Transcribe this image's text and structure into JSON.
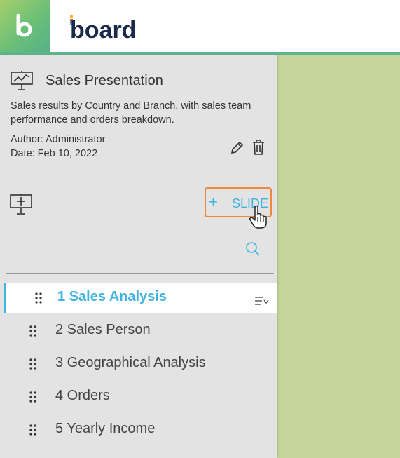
{
  "header": {
    "logo_text": "board"
  },
  "presentation": {
    "title": "Sales Presentation",
    "description": "Sales results by Country and Branch, with sales team performance and orders breakdown.",
    "author": "Author: Administrator",
    "date": "Date: Feb 10, 2022"
  },
  "toolbar": {
    "add_slide_plus": "+",
    "add_slide_label": "SLIDE"
  },
  "slides": [
    {
      "label": "1 Sales Analysis",
      "active": true
    },
    {
      "label": "2 Sales Person"
    },
    {
      "label": "3 Geographical Analysis"
    },
    {
      "label": "4 Orders"
    },
    {
      "label": "5 Yearly Income"
    }
  ],
  "colors": {
    "accent": "#3fb4e0",
    "highlight_border": "#f0883a",
    "canvas": "#c5d69c",
    "panel": "#e3e3e3"
  },
  "icons": [
    "presentation-icon",
    "edit-icon",
    "trash-icon",
    "add-presentation-icon",
    "plus-icon",
    "hand-cursor-icon",
    "search-icon",
    "drag-handle-icon",
    "slide-menu-icon"
  ]
}
